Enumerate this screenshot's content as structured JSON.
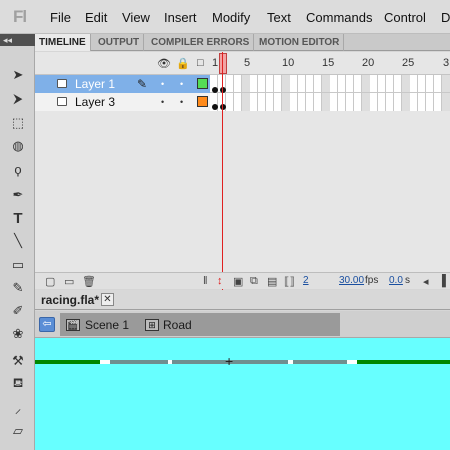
{
  "menu": {
    "logo": "Fl",
    "items": [
      "File",
      "Edit",
      "View",
      "Insert",
      "Modify",
      "Text",
      "Commands",
      "Control",
      "D"
    ]
  },
  "panel_tabs": [
    "TIMELINE",
    "OUTPUT",
    "COMPILER ERRORS",
    "MOTION EDITOR"
  ],
  "timeline": {
    "frame_numbers": [
      "1",
      "5",
      "10",
      "15",
      "20",
      "25",
      "3"
    ],
    "layers": [
      {
        "name": "Layer 1",
        "selected": true,
        "color": "#55dd55"
      },
      {
        "name": "Layer 3",
        "selected": false,
        "color": "#ff8a1a"
      }
    ],
    "current_frame": "2",
    "fps": "30.00",
    "fps_unit": "fps",
    "time": "0.0",
    "time_unit": "s"
  },
  "document": {
    "tab": "racing.fla*",
    "close": "✕"
  },
  "breadcrumb": {
    "scene": "Scene 1",
    "symbol": "Road"
  },
  "colors": {
    "stage": "#67ffff",
    "selected_layer": "#7fb0e8",
    "playhead": "#e02020"
  }
}
